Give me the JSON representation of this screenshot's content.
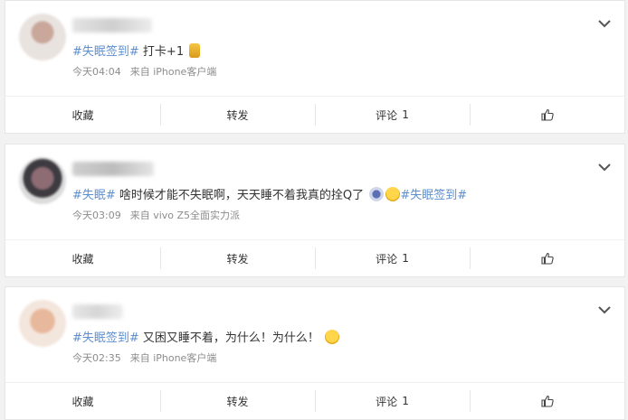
{
  "posts": [
    {
      "topic": "#失眠签到#",
      "text_before": "",
      "text_after": " 打卡+1",
      "time": "今天04:04",
      "source": "来自 iPhone客户端",
      "actions": {
        "collect": "收藏",
        "repost": "转发",
        "comment": "评论",
        "comment_count": "1"
      }
    },
    {
      "topic": "#失眠#",
      "text_mid": " 啥时候才能不失眠啊，天天睡不着我真的拴Q了",
      "topic2": "#失眠签到#",
      "time": "今天03:09",
      "source": "来自 vivo Z5全面实力派",
      "actions": {
        "collect": "收藏",
        "repost": "转发",
        "comment": "评论",
        "comment_count": "1"
      }
    },
    {
      "topic": "#失眠签到#",
      "text_after": " 又困又睡不着，为什么！为什么！",
      "time": "今天02:35",
      "source": "来自 iPhone客户端",
      "actions": {
        "collect": "收藏",
        "repost": "转发",
        "comment": "评论",
        "comment_count": "1"
      }
    }
  ],
  "icons": {
    "more": "chevron-down-icon",
    "like": "thumbs-up-icon",
    "emoji1": "trophy-emoji",
    "emoji2": "sticker-emoji",
    "emoji3": "crying-emoji"
  },
  "colors": {
    "topic": "#5d8fcf",
    "meta": "#8c8c8c",
    "background": "#f2f2f2"
  }
}
